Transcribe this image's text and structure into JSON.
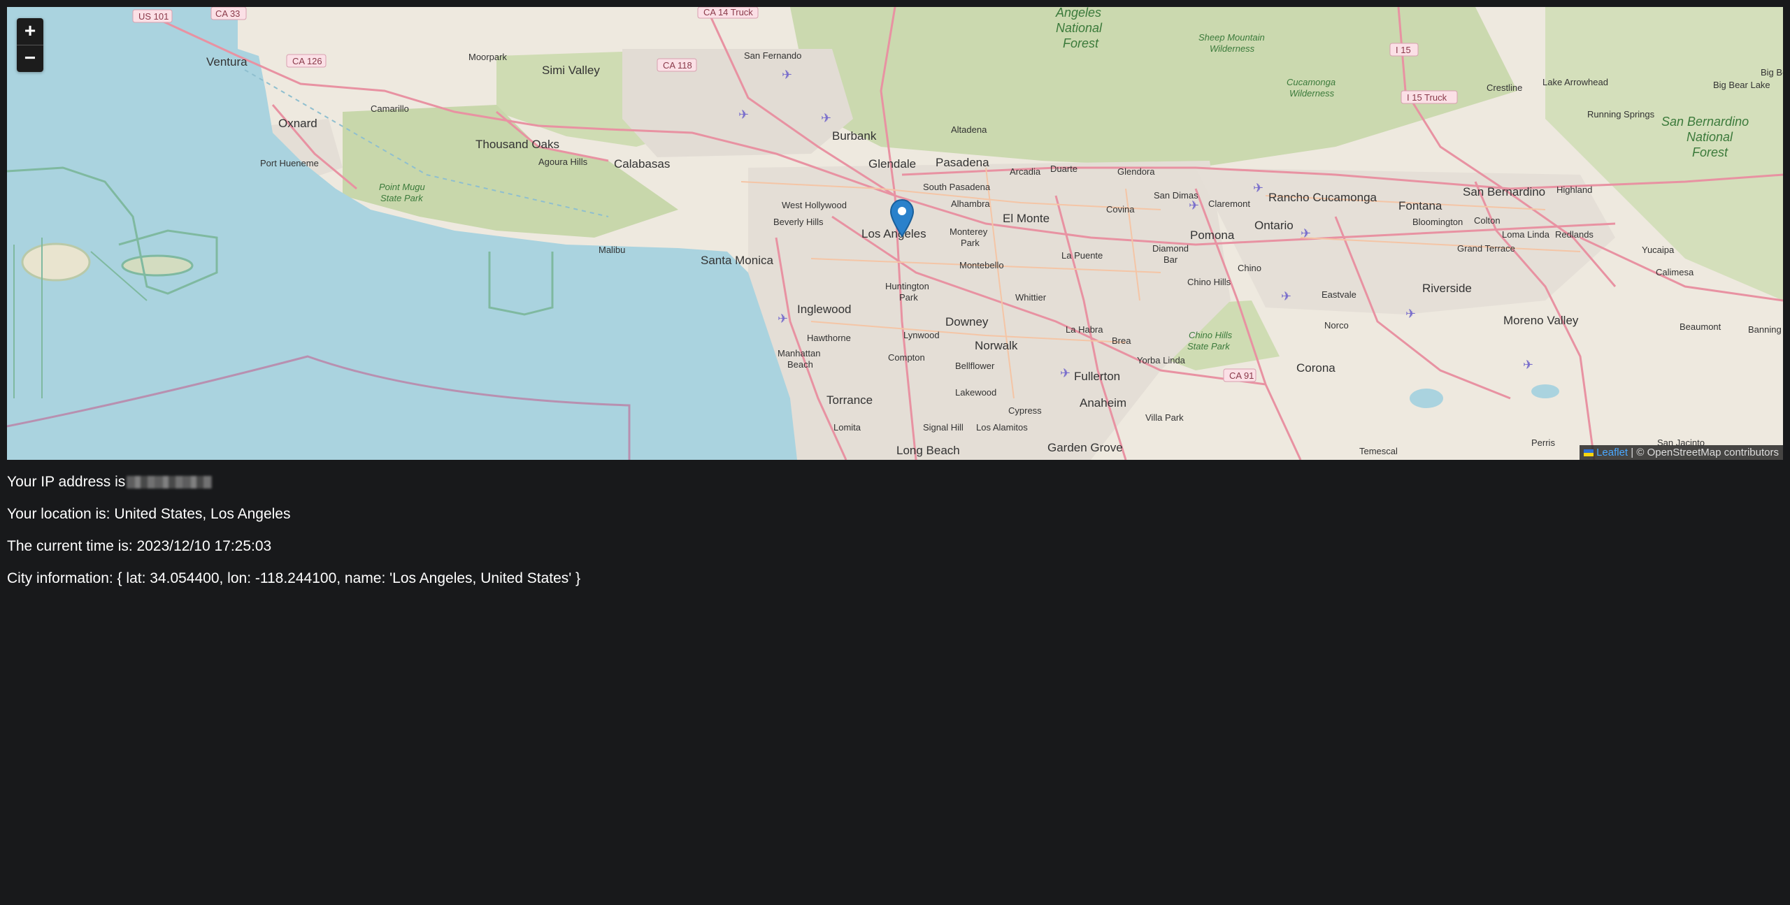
{
  "map": {
    "zoom_in_label": "+",
    "zoom_out_label": "−",
    "attribution": {
      "leaflet_link": "Leaflet",
      "separator": " | ",
      "osm_text": "© OpenStreetMap contributors"
    },
    "marker_icon": "map-pin-icon",
    "marker_color": "#2a81cb",
    "place_labels": {
      "ventura": "Ventura",
      "oxnard": "Oxnard",
      "port_hueneme": "Port Hueneme",
      "camarillo": "Camarillo",
      "moorpark": "Moorpark",
      "simi_valley": "Simi Valley",
      "thousand_oaks": "Thousand Oaks",
      "agoura_hills": "Agoura Hills",
      "calabasas": "Calabasas",
      "point_mugu": "Point Mugu",
      "state_park": "State Park",
      "malibu": "Malibu",
      "santa_monica": "Santa Monica",
      "san_fernando": "San Fernando",
      "burbank": "Burbank",
      "glendale": "Glendale",
      "pasadena": "Pasadena",
      "altadena": "Altadena",
      "west_hollywood": "West Hollywood",
      "beverly_hills": "Beverly Hills",
      "los_angeles": "Los Angeles",
      "south_pasadena": "South Pasadena",
      "alhambra": "Alhambra",
      "arcadia": "Arcadia",
      "duarte": "Duarte",
      "glendora": "Glendora",
      "el_monte": "El Monte",
      "monterey_park_1": "Monterey",
      "monterey_park_2": "Park",
      "montebello": "Montebello",
      "covina": "Covina",
      "san_dimas": "San Dimas",
      "claremont": "Claremont",
      "pomona": "Pomona",
      "la_puente": "La Puente",
      "diamond_bar_1": "Diamond",
      "diamond_bar_2": "Bar",
      "chino": "Chino",
      "chino_hills": "Chino Hills",
      "ontario": "Ontario",
      "rancho": "Rancho Cucamonga",
      "fontana": "Fontana",
      "san_bernardino": "San Bernardino",
      "highland": "Highland",
      "bloomington": "Bloomington",
      "colton": "Colton",
      "loma_linda": "Loma Linda",
      "redlands": "Redlands",
      "grand_terrace": "Grand Terrace",
      "yucaipa": "Yucaipa",
      "calimesa": "Calimesa",
      "riverside": "Riverside",
      "eastvale": "Eastvale",
      "norco": "Norco",
      "corona": "Corona",
      "moreno_valley": "Moreno Valley",
      "beaumont": "Beaumont",
      "banning": "Banning",
      "perris": "Perris",
      "temescal": "Temescal",
      "san_jacinto": "San Jacinto",
      "crestline": "Crestline",
      "lake_arrowhead": "Lake Arrowhead",
      "big_bear_lake": "Big Bear Lake",
      "big_bear": "Big Be",
      "running_springs": "Running Springs",
      "sb_forest_1": "San Bernardino",
      "sb_forest_2": "National",
      "sb_forest_3": "Forest",
      "anf_1": "Angeles",
      "anf_2": "National",
      "anf_3": "Forest",
      "sheep_1": "Sheep Mountain",
      "sheep_2": "Wilderness",
      "cuca_1": "Cucamonga",
      "cuca_2": "Wilderness",
      "inglewood": "Inglewood",
      "hawthorne": "Hawthorne",
      "manhattan_1": "Manhattan",
      "manhattan_2": "Beach",
      "huntington_1": "Huntington",
      "huntington_2": "Park",
      "lynwood": "Lynwood",
      "compton": "Compton",
      "downey": "Downey",
      "whittier": "Whittier",
      "norwalk": "Norwalk",
      "la_habra": "La Habra",
      "brea": "Brea",
      "bellflower": "Bellflower",
      "fullerton": "Fullerton",
      "yorba_linda": "Yorba Linda",
      "chino_hills_sp_1": "Chino Hills",
      "chino_hills_sp_2": "State Park",
      "torrance": "Torrance",
      "lomita": "Lomita",
      "lakewood": "Lakewood",
      "cypress": "Cypress",
      "anaheim": "Anaheim",
      "villa_park": "Villa Park",
      "signal_hill": "Signal Hill",
      "los_alamitos": "Los Alamitos",
      "long_beach": "Long Beach",
      "garden_grove": "Garden Grove"
    },
    "shields": {
      "us101": "US 101",
      "ca33": "CA 33",
      "ca14": "CA 14 Truck",
      "ca126": "CA 126",
      "ca118": "CA 118",
      "i15": "I 15",
      "i15truck": "I 15 Truck",
      "ca91": "CA 91"
    }
  },
  "info": {
    "ip_label": "Your IP address is",
    "location": "Your location is: United States, Los Angeles",
    "time": "The current time is: 2023/12/10 17:25:03",
    "city": "City information: { lat: 34.054400, lon: -118.244100, name: 'Los Angeles, United States' }"
  },
  "colors": {
    "background": "#18191b",
    "ocean": "#aad3df",
    "land": "#eee9df",
    "park": "#c8d7ab",
    "road": "#e892a2",
    "leaflet_link": "#4aa8ff"
  }
}
